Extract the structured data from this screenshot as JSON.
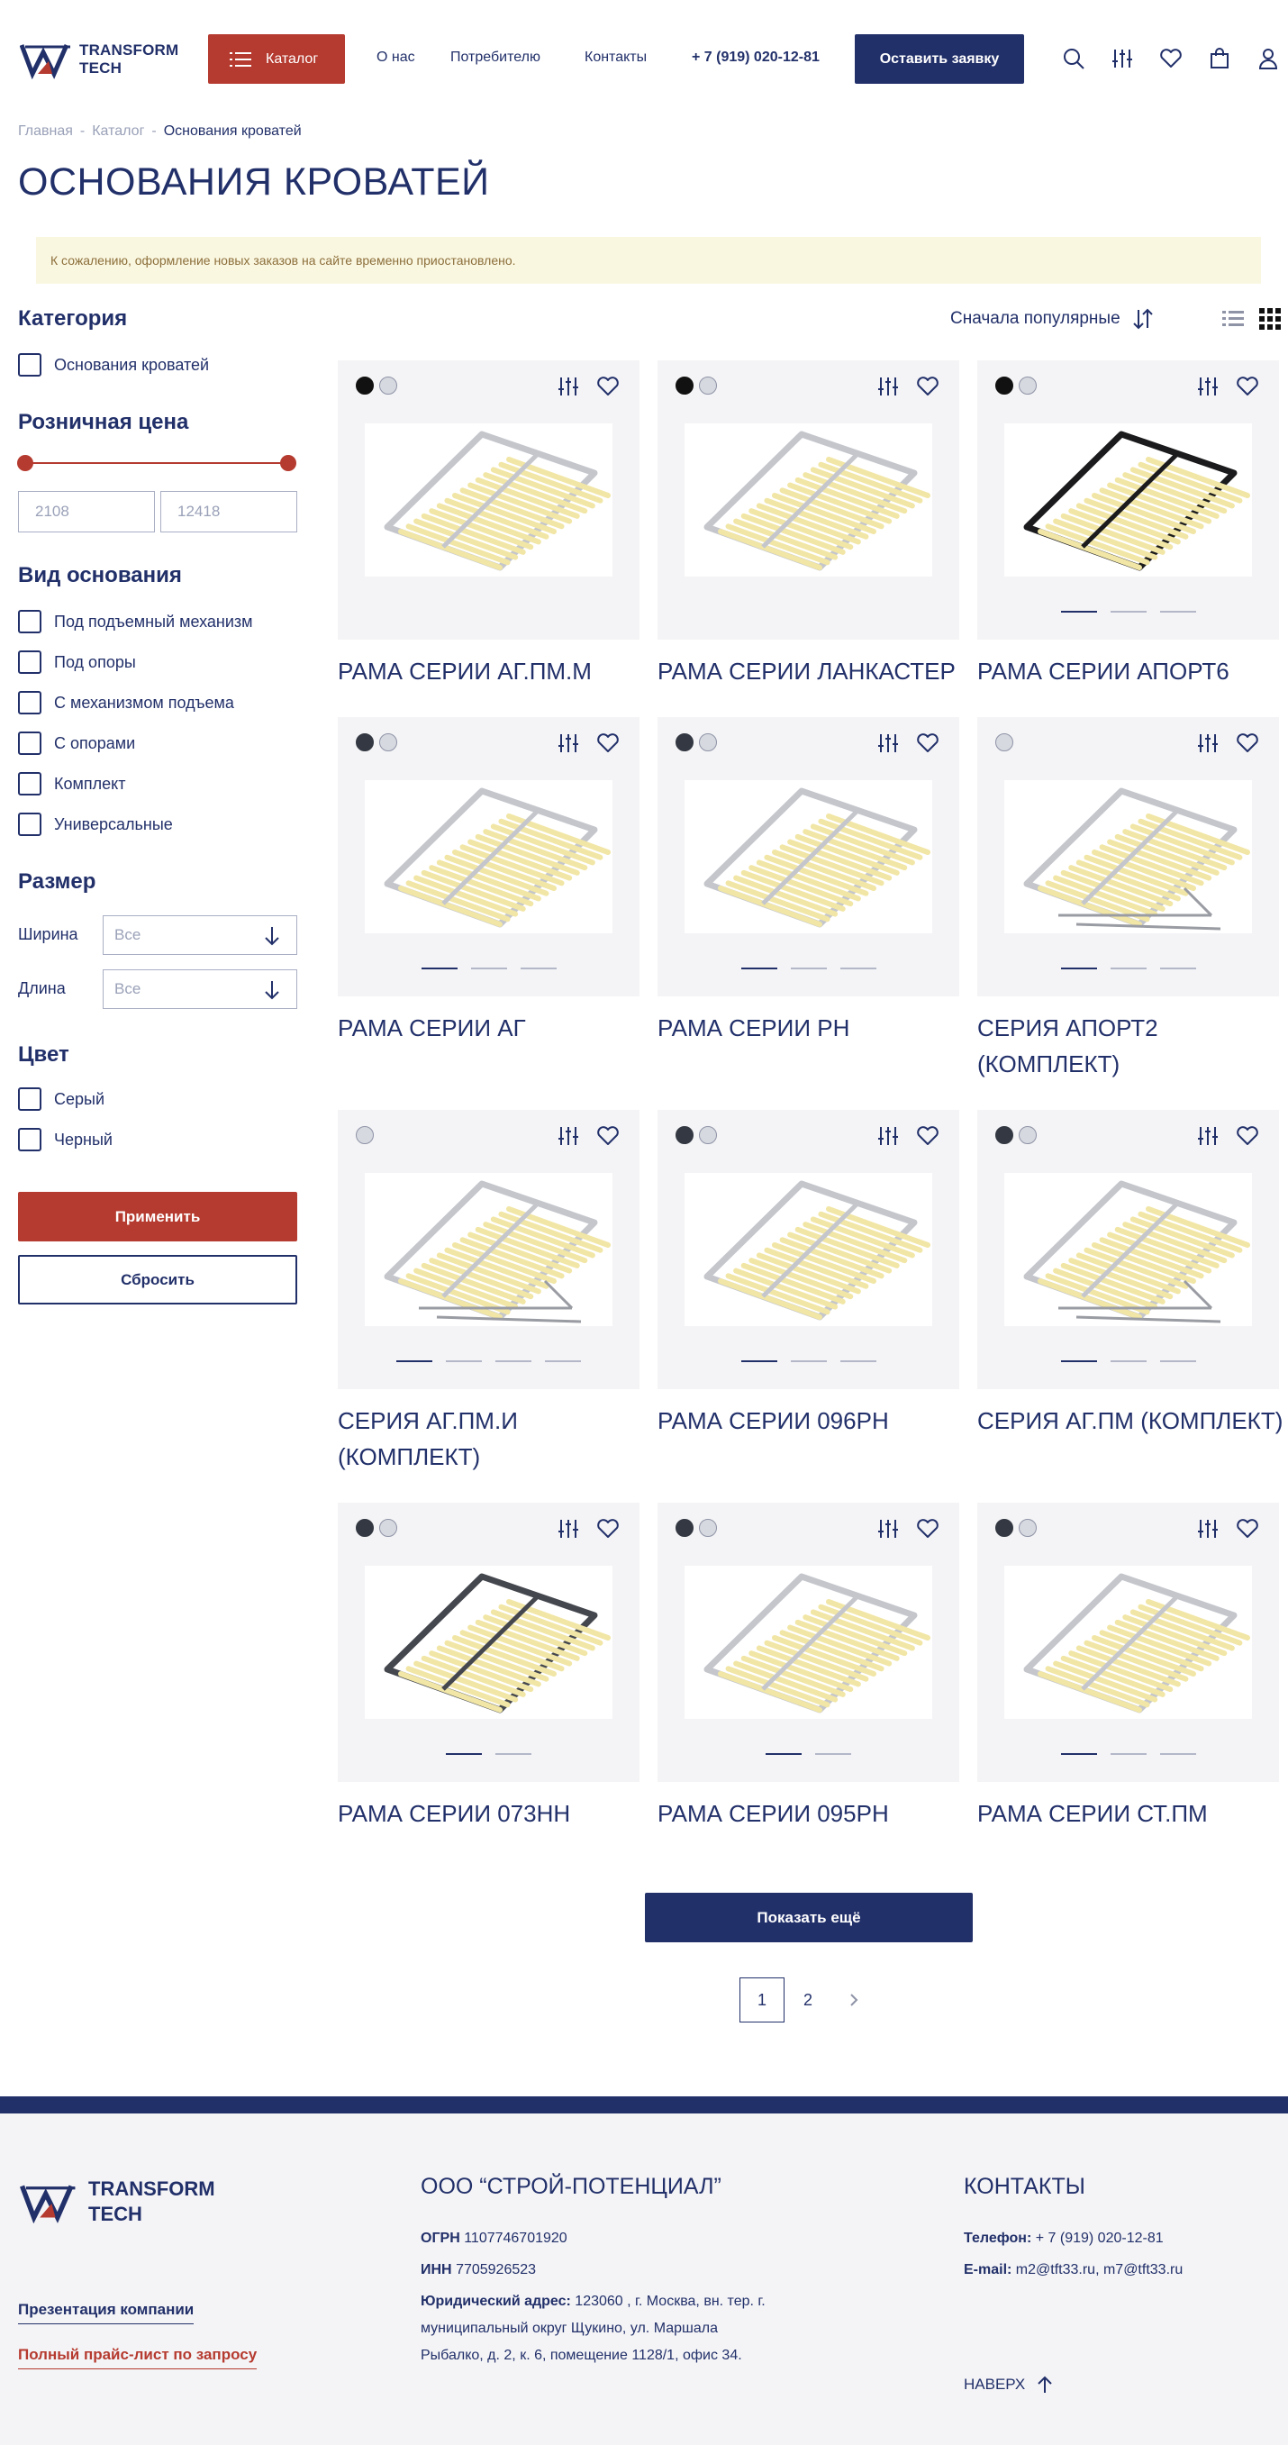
{
  "header": {
    "logo_line1": "TRANSFORM",
    "logo_line2": "TECH",
    "catalog_label": "Каталог",
    "nav": [
      "О нас",
      "Потребителю",
      "Контакты"
    ],
    "phone": "+ 7 (919) 020-12-81",
    "lead_button": "Оставить заявку",
    "icons": [
      "search-icon",
      "compare-icon",
      "heart-icon",
      "cart-icon",
      "user-icon"
    ]
  },
  "breadcrumb": [
    "Главная",
    "Каталог",
    "Основания кроватей"
  ],
  "page_title": "ОСНОВАНИЯ КРОВАТЕЙ",
  "notice": "К сожалению, оформление новых заказов на сайте временно приостановлено.",
  "filters": {
    "category_title": "Категория",
    "category_items": [
      "Основания кроватей"
    ],
    "price_title": "Розничная цена",
    "price_min": "2108",
    "price_max": "12418",
    "type_title": "Вид основания",
    "type_items": [
      "Под подъемный механизм",
      "Под опоры",
      "С механизмом подъема",
      "С опорами",
      "Комплект",
      "Универсальные"
    ],
    "size_title": "Размер",
    "width_label": "Ширина",
    "length_label": "Длина",
    "select_placeholder": "Все",
    "color_title": "Цвет",
    "color_items": [
      "Серый",
      "Черный"
    ],
    "apply": "Применить",
    "reset": "Сбросить"
  },
  "sort_label": "Сначала популярные",
  "products": [
    {
      "name": "РАМА СЕРИИ АГ.ПМ.М",
      "swatches": [
        "black",
        "grey"
      ],
      "frame": "grey",
      "lift": false,
      "dots": 0,
      "active": 0
    },
    {
      "name": "РАМА СЕРИИ ЛАНКАСТЕР",
      "swatches": [
        "black",
        "grey"
      ],
      "frame": "grey",
      "lift": false,
      "dots": 0,
      "active": 0
    },
    {
      "name": "РАМА СЕРИИ АПОРТ6",
      "swatches": [
        "black",
        "grey"
      ],
      "frame": "black",
      "lift": false,
      "dots": 3,
      "active": 0
    },
    {
      "name": "РАМА СЕРИИ АГ",
      "swatches": [
        "dark",
        "grey"
      ],
      "frame": "grey",
      "lift": false,
      "dots": 3,
      "active": 0
    },
    {
      "name": "РАМА СЕРИИ РН",
      "swatches": [
        "dark",
        "grey"
      ],
      "frame": "grey",
      "lift": false,
      "dots": 3,
      "active": 0
    },
    {
      "name": "СЕРИЯ АПОРТ2 (КОМПЛЕКТ)",
      "swatches": [
        "grey"
      ],
      "frame": "grey",
      "lift": true,
      "dots": 3,
      "active": 0
    },
    {
      "name": "СЕРИЯ АГ.ПМ.И (КОМПЛЕКТ)",
      "swatches": [
        "grey"
      ],
      "frame": "grey",
      "lift": true,
      "dots": 4,
      "active": 0
    },
    {
      "name": "РАМА СЕРИИ 096РН",
      "swatches": [
        "dark",
        "grey"
      ],
      "frame": "grey",
      "lift": false,
      "dots": 3,
      "active": 0
    },
    {
      "name": "СЕРИЯ АГ.ПМ (КОМПЛЕКТ)",
      "swatches": [
        "dark",
        "grey"
      ],
      "frame": "grey",
      "lift": true,
      "dots": 3,
      "active": 0
    },
    {
      "name": "РАМА СЕРИИ 073НН",
      "swatches": [
        "dark",
        "grey"
      ],
      "frame": "dark",
      "lift": false,
      "dots": 2,
      "active": 0
    },
    {
      "name": "РАМА СЕРИИ 095РН",
      "swatches": [
        "dark",
        "grey"
      ],
      "frame": "grey",
      "lift": false,
      "dots": 2,
      "active": 0
    },
    {
      "name": "РАМА СЕРИИ СТ.ПМ",
      "swatches": [
        "dark",
        "grey"
      ],
      "frame": "grey",
      "lift": false,
      "dots": 3,
      "active": 0
    }
  ],
  "show_more": "Показать ещё",
  "pagination": [
    "1",
    "2"
  ],
  "footer": {
    "logo_line1": "TRANSFORM",
    "logo_line2": "TECH",
    "presentation_link": "Презентация компании",
    "price_link": "Полный прайс-лист по запросу",
    "company_title": "ООО “СТРОЙ-ПОТЕНЦИАЛ”",
    "ogrn_label": "ОГРН",
    "ogrn": "1107746701920",
    "inn_label": "ИНН",
    "inn": "7705926523",
    "address_label": "Юридический адрес:",
    "address_1": "123060 , г. Москва, вн. тер. г.",
    "address_2": "муниципальный округ Щукино, ул. Маршала",
    "address_3": "Рыбалко, д. 2, к. 6, помещение 1128/1, офис 34.",
    "contacts_title": "КОНТАКТЫ",
    "phone_label": "Телефон:",
    "phone": "+ 7 (919) 020-12-81",
    "email_label": "E-mail:",
    "email": "m2@tft33.ru, m7@tft33.ru",
    "to_top": "НАВЕРХ"
  },
  "colors": {
    "navy": "#22306a",
    "red": "#b53a2f",
    "notice_bg": "#faf7e1",
    "card_bg": "#f4f4f6",
    "slat": "#f1e6a6"
  }
}
